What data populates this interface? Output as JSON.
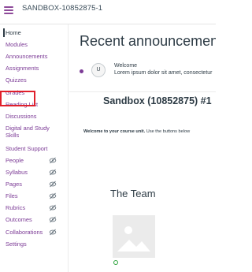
{
  "header": {
    "course_code": "SANDBOX-10852875-1"
  },
  "sidebar": {
    "items": [
      {
        "label": "Home",
        "active": true,
        "hidden": false
      },
      {
        "label": "Modules",
        "active": false,
        "hidden": false
      },
      {
        "label": "Announcements",
        "active": false,
        "hidden": false
      },
      {
        "label": "Assignments",
        "active": false,
        "hidden": false
      },
      {
        "label": "Quizzes",
        "active": false,
        "hidden": false
      },
      {
        "label": "Grades",
        "active": false,
        "hidden": false,
        "highlighted": true
      },
      {
        "label": "Reading List",
        "active": false,
        "hidden": false
      },
      {
        "label": "Discussions",
        "active": false,
        "hidden": false
      },
      {
        "label": "Digital and Study Skills",
        "active": false,
        "hidden": false
      },
      {
        "label": "Student Support",
        "active": false,
        "hidden": false
      },
      {
        "label": "People",
        "active": false,
        "hidden": true
      },
      {
        "label": "Syllabus",
        "active": false,
        "hidden": true
      },
      {
        "label": "Pages",
        "active": false,
        "hidden": true
      },
      {
        "label": "Files",
        "active": false,
        "hidden": true
      },
      {
        "label": "Rubrics",
        "active": false,
        "hidden": true
      },
      {
        "label": "Outcomes",
        "active": false,
        "hidden": true
      },
      {
        "label": "Collaborations",
        "active": false,
        "hidden": true
      },
      {
        "label": "Settings",
        "active": false,
        "hidden": false
      }
    ],
    "highlight_color": "#e0202b",
    "link_color": "#7c3b96"
  },
  "main": {
    "announcements_title": "Recent announcement",
    "announcement": {
      "avatar_initial": "U",
      "title": "Welcome",
      "snippet": "Lorem ipsum dolor sit amet, consectetur"
    },
    "course_title": "Sandbox (10852875) #1",
    "welcome_bold": "Welcome to your course unit.",
    "welcome_rest": " Use the buttons below",
    "team_title": "The Team"
  },
  "icons": {
    "menu": "hamburger-icon",
    "hidden": "eye-slash-icon",
    "image": "image-placeholder-icon"
  }
}
